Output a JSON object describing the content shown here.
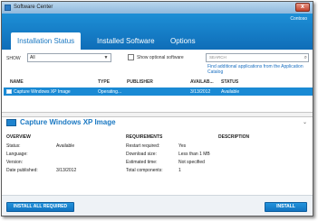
{
  "window": {
    "title": "Software Center",
    "close_label": "x"
  },
  "header": {
    "organization": "Contoso",
    "tabs": [
      {
        "label": "Installation Status"
      },
      {
        "label": "Installed Software"
      },
      {
        "label": "Options"
      }
    ]
  },
  "filters": {
    "show_label": "SHOW",
    "show_value": "All",
    "optional_label": "Show optional software",
    "search_placeholder": "SEARCH",
    "find_link": "Find additional applications from the Application Catalog"
  },
  "table": {
    "columns": [
      "NAME",
      "TYPE",
      "PUBLISHER",
      "AVAILAB...",
      "STATUS"
    ],
    "rows": [
      {
        "name": "Capture Windows XP Image",
        "type": "Operating...",
        "publisher": "",
        "available": "3/13/2012",
        "status": "Available"
      }
    ]
  },
  "detail": {
    "title": "Capture Windows XP Image",
    "overview": {
      "heading": "OVERVIEW",
      "status_label": "Status:",
      "status_value": "Available",
      "language_label": "Language:",
      "version_label": "Version:",
      "date_label": "Date published:",
      "date_value": "3/13/2012"
    },
    "requirements": {
      "heading": "REQUIREMENTS",
      "restart_label": "Restart required:",
      "restart_value": "Yes",
      "download_label": "Download size:",
      "download_value": "Less than 1 MB",
      "time_label": "Estimated time:",
      "time_value": "Not specified",
      "components_label": "Total components:",
      "components_value": "1"
    },
    "description": {
      "heading": "DESCRIPTION"
    }
  },
  "footer": {
    "install_all_label": "INSTALL ALL REQUIRED",
    "install_label": "INSTALL"
  },
  "colors": {
    "accent": "#1a8ad4",
    "header": "#1d8fd6",
    "title_text": "#1a78c2"
  }
}
